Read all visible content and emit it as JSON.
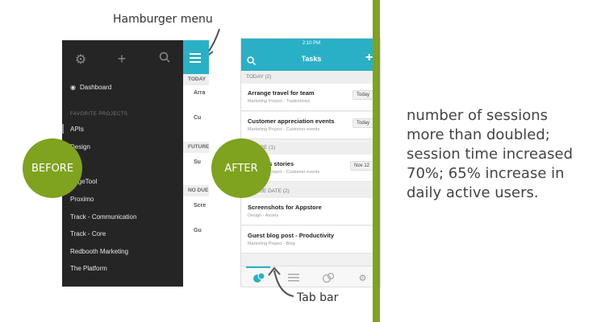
{
  "annotations": {
    "hamburger": "Hamburger menu",
    "tabbar": "Tab bar"
  },
  "before": {
    "label": "BEFORE",
    "sidebar": {
      "icons": [
        "gear-icon",
        "plus-icon",
        "search-icon"
      ],
      "dashboard": "Dashboard",
      "section_header": "FAVORITE PROJECTS",
      "items": [
        {
          "label": "APIs"
        },
        {
          "label": "Design"
        },
        {
          "label": "PageTool"
        },
        {
          "label": "Proximo"
        },
        {
          "label": "Track - Communication"
        },
        {
          "label": "Track - Core"
        },
        {
          "label": "Redbooth Marketing"
        },
        {
          "label": "The Platform"
        }
      ]
    },
    "strip": {
      "sections": [
        "TODAY",
        "FUTURE",
        "NO DUE DATE"
      ],
      "rows": [
        "Arra",
        "Cu",
        "Su",
        "Scre",
        "Gu"
      ]
    }
  },
  "after": {
    "label": "AFTER",
    "status_time": "2:10 PM",
    "title": "Tasks",
    "sections": [
      {
        "header": "TODAY",
        "count": "(2)",
        "tasks": [
          {
            "title": "Arrange travel for team",
            "subtitle": "Marketing Project - Tradeshows",
            "date": "Today"
          },
          {
            "title": "Customer appreciation events",
            "subtitle": "Marketing Project - Customer events",
            "date": "Today"
          }
        ]
      },
      {
        "header": "FUTURE",
        "count": "(1)",
        "tasks": [
          {
            "title": "Success stories",
            "subtitle": "Marketing Project - Customer events",
            "date": "Nov 12"
          }
        ]
      },
      {
        "header": "NO DUE DATE",
        "count": "(2)",
        "tasks": [
          {
            "title": "Screenshots for Appstore",
            "subtitle": "Design - Assets",
            "date": ""
          },
          {
            "title": "Guest blog post - Productivity",
            "subtitle": "Marketing Project - Blog",
            "date": ""
          }
        ]
      }
    ],
    "tabs": [
      "tasks-tab-icon",
      "activity-tab-icon",
      "notifications-tab-icon",
      "settings-tab-icon"
    ]
  },
  "result": {
    "text": "number of sessions more than doubled; session time increased 70%; 65% increase in daily active users."
  },
  "colors": {
    "accent_teal": "#2ab0c6",
    "accent_green": "#7fa21f",
    "sidebar_dark": "#252525"
  }
}
